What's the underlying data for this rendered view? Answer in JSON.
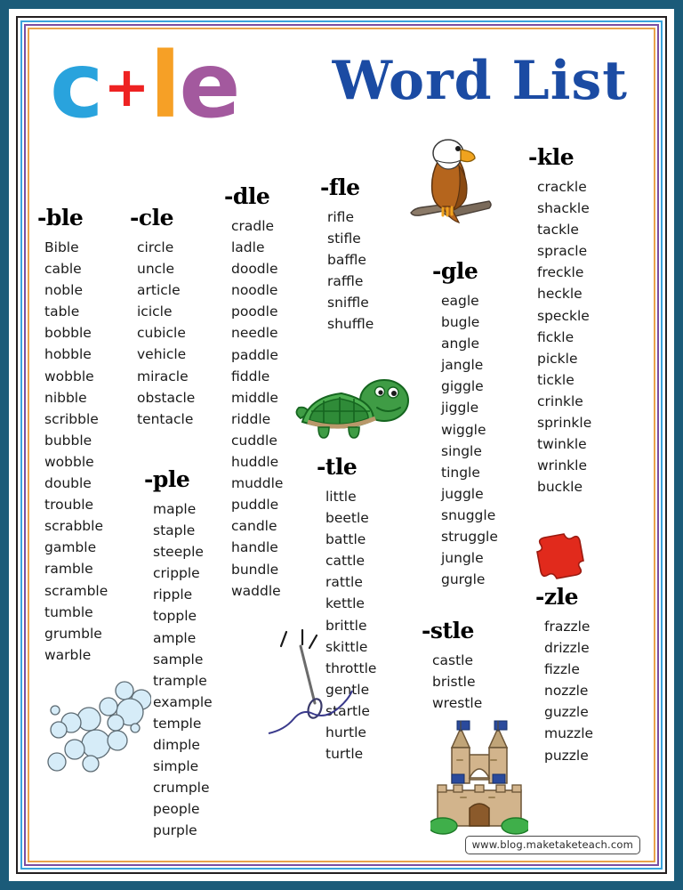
{
  "header": {
    "logo": {
      "c": "c",
      "plus": "+",
      "l": "l",
      "e": "e"
    },
    "title": "Word List"
  },
  "colors": {
    "logo_c": "#29a3dd",
    "logo_plus": "#ee2222",
    "logo_l": "#f6a026",
    "logo_e": "#a3599e",
    "title": "#1b4ba3",
    "page_border_outer": "#1b5b79",
    "frame_black": "#231f20",
    "frame_blue": "#3aa3dc",
    "frame_purple": "#7b4ea3",
    "frame_orange": "#e9a24a"
  },
  "columns": [
    {
      "id": "ble",
      "heading": "-ble",
      "words": [
        "Bible",
        "cable",
        "noble",
        "table",
        "bobble",
        "hobble",
        "wobble",
        "nibble",
        "scribble",
        "bubble",
        "wobble",
        "double",
        "trouble",
        "scrabble",
        "gamble",
        "ramble",
        "scramble",
        "tumble",
        "grumble",
        "warble"
      ]
    },
    {
      "id": "cle",
      "heading": "-cle",
      "words": [
        "circle",
        "uncle",
        "article",
        "icicle",
        "cubicle",
        "vehicle",
        "miracle",
        "obstacle",
        "tentacle"
      ]
    },
    {
      "id": "ple",
      "heading": "-ple",
      "words": [
        "maple",
        "staple",
        "steeple",
        "cripple",
        "ripple",
        "topple",
        "ample",
        "sample",
        "trample",
        "example",
        "temple",
        "dimple",
        "simple",
        "crumple",
        "people",
        "purple"
      ]
    },
    {
      "id": "dle",
      "heading": "-dle",
      "words": [
        "cradle",
        "ladle",
        "doodle",
        "noodle",
        "poodle",
        "needle",
        "paddle",
        "fiddle",
        "middle",
        "riddle",
        "cuddle",
        "huddle",
        "muddle",
        "puddle",
        "candle",
        "handle",
        "bundle",
        "waddle"
      ]
    },
    {
      "id": "fle",
      "heading": "-fle",
      "words": [
        "rifle",
        "stifle",
        "baffle",
        "raffle",
        "sniffle",
        "shuffle"
      ]
    },
    {
      "id": "tle",
      "heading": "-tle",
      "words": [
        "little",
        "beetle",
        "battle",
        "cattle",
        "rattle",
        "kettle",
        "brittle",
        "skittle",
        "throttle",
        "gentle",
        "startle",
        "hurtle",
        "turtle"
      ]
    },
    {
      "id": "gle",
      "heading": "-gle",
      "words": [
        "eagle",
        "bugle",
        "angle",
        "jangle",
        "giggle",
        "jiggle",
        "wiggle",
        "single",
        "tingle",
        "juggle",
        "snuggle",
        "struggle",
        "jungle",
        "gurgle"
      ]
    },
    {
      "id": "stle",
      "heading": "-stle",
      "words": [
        "castle",
        "bristle",
        "wrestle"
      ]
    },
    {
      "id": "kle",
      "heading": "-kle",
      "words": [
        "crackle",
        "shackle",
        "tackle",
        "spracle",
        "freckle",
        "heckle",
        "speckle",
        "fickle",
        "pickle",
        "tickle",
        "crinkle",
        "sprinkle",
        "twinkle",
        "wrinkle",
        "buckle"
      ]
    },
    {
      "id": "zle",
      "heading": "-zle",
      "words": [
        "frazzle",
        "drizzle",
        "fizzle",
        "nozzle",
        "guzzle",
        "muzzle",
        "puzzle"
      ]
    }
  ],
  "illustrations": [
    {
      "id": "eagle",
      "name": "eagle-illustration"
    },
    {
      "id": "turtle",
      "name": "turtle-illustration"
    },
    {
      "id": "castle",
      "name": "castle-illustration"
    },
    {
      "id": "bubbles",
      "name": "bubbles-illustration"
    },
    {
      "id": "needle",
      "name": "needle-and-thread-illustration"
    },
    {
      "id": "puzzle",
      "name": "puzzle-piece-illustration"
    }
  ],
  "footer": {
    "watermark": "www.blog.maketaketeach.com"
  }
}
